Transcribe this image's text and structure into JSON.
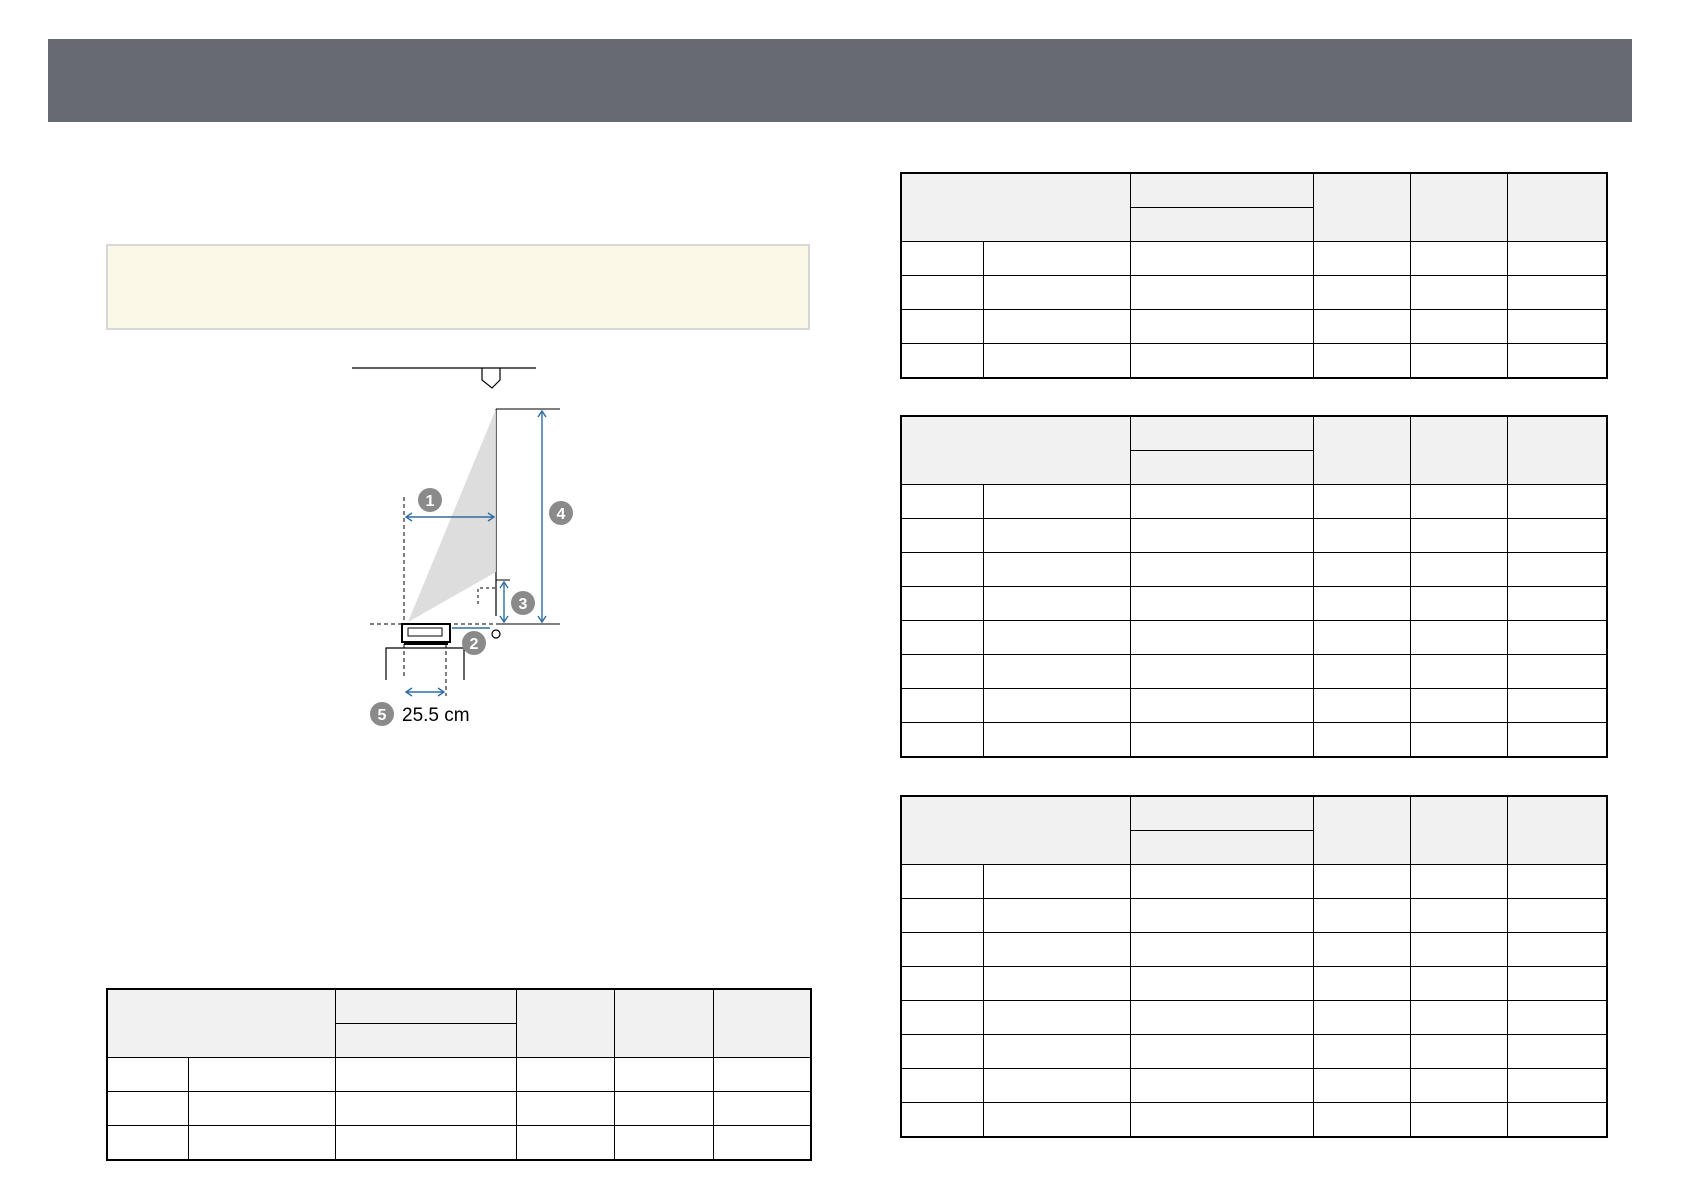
{
  "figure": {
    "callouts": [
      "1",
      "2",
      "3",
      "4",
      "5"
    ],
    "dimension_label": "25.5 cm"
  },
  "tables": [
    {
      "id": "table-bottom-left",
      "rows": 3
    },
    {
      "id": "table-right-1",
      "rows": 4
    },
    {
      "id": "table-right-2",
      "rows": 8
    },
    {
      "id": "table-right-3",
      "rows": 8
    }
  ]
}
